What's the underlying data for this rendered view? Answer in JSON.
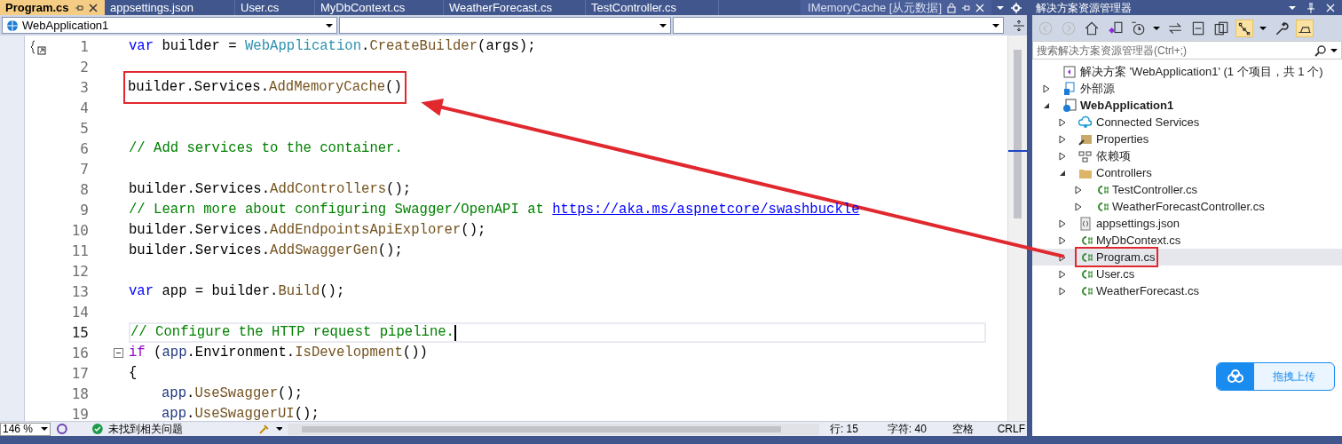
{
  "tabs": [
    {
      "label": "Program.cs",
      "selected": true,
      "pinned": true
    },
    {
      "label": "appsettings.json",
      "selected": false,
      "pinned": false
    },
    {
      "label": "User.cs",
      "selected": false,
      "pinned": false
    },
    {
      "label": "MyDbContext.cs",
      "selected": false,
      "pinned": false
    },
    {
      "label": "WeatherForecast.cs",
      "selected": false,
      "pinned": false
    },
    {
      "label": "TestController.cs",
      "selected": false,
      "pinned": false
    }
  ],
  "preview_tab": {
    "label": "IMemoryCache [从元数据]"
  },
  "nav_bar": {
    "project": "WebApplication1"
  },
  "code_lines": [
    {
      "number": "1",
      "current": false,
      "boxed": false,
      "foldable": false,
      "indented": false,
      "tokens": [
        {
          "text": "var",
          "kind": "keyword"
        },
        {
          "text": " builder = ",
          "kind": "plain"
        },
        {
          "text": "WebApplication",
          "kind": "type"
        },
        {
          "text": ".",
          "kind": "plain"
        },
        {
          "text": "CreateBuilder",
          "kind": "method"
        },
        {
          "text": "(args);",
          "kind": "plain"
        }
      ]
    },
    {
      "number": "2"
    },
    {
      "number": "3",
      "current": false,
      "boxed": true,
      "foldable": false,
      "indented": false,
      "tokens": [
        {
          "text": "builder.Services.",
          "kind": "plain"
        },
        {
          "text": "AddMemoryCache",
          "kind": "method"
        },
        {
          "text": "()",
          "kind": "plain"
        }
      ]
    },
    {
      "number": "4"
    },
    {
      "number": "5"
    },
    {
      "number": "6",
      "current": false,
      "boxed": false,
      "foldable": false,
      "indented": false,
      "tokens": [
        {
          "text": "// Add services to the container.",
          "kind": "comment"
        }
      ]
    },
    {
      "number": "7"
    },
    {
      "number": "8",
      "current": false,
      "boxed": false,
      "foldable": false,
      "indented": false,
      "tokens": [
        {
          "text": "builder.Services.",
          "kind": "plain"
        },
        {
          "text": "AddControllers",
          "kind": "method"
        },
        {
          "text": "();",
          "kind": "plain"
        }
      ]
    },
    {
      "number": "9",
      "current": false,
      "boxed": false,
      "foldable": false,
      "indented": false,
      "tokens": [
        {
          "text": "// Learn more about configuring Swagger/OpenAPI at ",
          "kind": "comment"
        },
        {
          "text": "https://aka.ms/aspnetcore/swashbuckle",
          "kind": "link"
        }
      ]
    },
    {
      "number": "10",
      "current": false,
      "boxed": false,
      "foldable": false,
      "indented": false,
      "tokens": [
        {
          "text": "builder.Services.",
          "kind": "plain"
        },
        {
          "text": "AddEndpointsApiExplorer",
          "kind": "method"
        },
        {
          "text": "();",
          "kind": "plain"
        }
      ]
    },
    {
      "number": "11",
      "current": false,
      "boxed": false,
      "foldable": false,
      "indented": false,
      "tokens": [
        {
          "text": "builder.Services.",
          "kind": "plain"
        },
        {
          "text": "AddSwaggerGen",
          "kind": "method"
        },
        {
          "text": "();",
          "kind": "plain"
        }
      ]
    },
    {
      "number": "12"
    },
    {
      "number": "13",
      "current": false,
      "boxed": false,
      "foldable": false,
      "indented": false,
      "tokens": [
        {
          "text": "var",
          "kind": "keyword"
        },
        {
          "text": " app = builder.",
          "kind": "plain"
        },
        {
          "text": "Build",
          "kind": "method"
        },
        {
          "text": "();",
          "kind": "plain"
        }
      ]
    },
    {
      "number": "14"
    },
    {
      "number": "15",
      "current": true,
      "boxed": false,
      "foldable": false,
      "indented": false,
      "tokens": [
        {
          "text": "// Configure the HTTP request pipeline.",
          "kind": "comment"
        }
      ]
    },
    {
      "number": "16",
      "current": false,
      "boxed": false,
      "foldable": true,
      "indented": false,
      "tokens": [
        {
          "text": "if",
          "kind": "control"
        },
        {
          "text": " (",
          "kind": "plain"
        },
        {
          "text": "app",
          "kind": "variable"
        },
        {
          "text": ".Environment.",
          "kind": "plain"
        },
        {
          "text": "IsDevelopment",
          "kind": "method"
        },
        {
          "text": "())",
          "kind": "plain"
        }
      ]
    },
    {
      "number": "17",
      "current": false,
      "boxed": false,
      "foldable": false,
      "indented": false,
      "tokens": [
        {
          "text": "{",
          "kind": "plain"
        }
      ]
    },
    {
      "number": "18",
      "current": false,
      "boxed": false,
      "foldable": false,
      "indented": true,
      "tokens": [
        {
          "text": "app",
          "kind": "variable"
        },
        {
          "text": ".",
          "kind": "plain"
        },
        {
          "text": "UseSwagger",
          "kind": "method"
        },
        {
          "text": "();",
          "kind": "plain"
        }
      ]
    },
    {
      "number": "19",
      "current": false,
      "boxed": false,
      "foldable": false,
      "indented": true,
      "tokens": [
        {
          "text": "app",
          "kind": "variable"
        },
        {
          "text": ".",
          "kind": "plain"
        },
        {
          "text": "UseSwaggerUI",
          "kind": "method"
        },
        {
          "text": "();",
          "kind": "plain"
        }
      ]
    }
  ],
  "status_bar": {
    "zoom": "146 %",
    "issues": "未找到相关问题",
    "line": "行: 15",
    "char": "字符: 40",
    "spacing": "空格",
    "line_ending": "CRLF"
  },
  "solution_explorer": {
    "title": "解决方案资源管理器",
    "search": {
      "placeholder": "搜索解决方案资源管理器(Ctrl+;)"
    },
    "tree": [
      {
        "label": "解决方案 'WebApplication1' (1 个项目，共 1 个)",
        "kind": "solution",
        "selected": false,
        "boxed": false
      },
      {
        "label": "外部源",
        "kind": "external",
        "expanded": false,
        "selected": false,
        "boxed": false
      },
      {
        "label": "WebApplication1",
        "kind": "project",
        "expanded": true,
        "selected": false,
        "boxed": false,
        "children": [
          {
            "label": "Connected Services",
            "kind": "service",
            "expanded": false,
            "selected": false,
            "boxed": false
          },
          {
            "label": "Properties",
            "kind": "properties",
            "expanded": false,
            "selected": false,
            "boxed": false
          },
          {
            "label": "依赖项",
            "kind": "dependencies",
            "expanded": false,
            "selected": false,
            "boxed": false
          },
          {
            "label": "Controllers",
            "kind": "folder",
            "expanded": true,
            "selected": false,
            "boxed": false,
            "children": [
              {
                "label": "TestController.cs",
                "kind": "cs",
                "expanded": false,
                "selected": false,
                "boxed": false
              },
              {
                "label": "WeatherForecastController.cs",
                "kind": "cs",
                "expanded": false,
                "selected": false,
                "boxed": false
              }
            ]
          },
          {
            "label": "appsettings.json",
            "kind": "json",
            "expanded": false,
            "selected": false,
            "boxed": false
          },
          {
            "label": "MyDbContext.cs",
            "kind": "cs",
            "expanded": false,
            "selected": false,
            "boxed": false
          },
          {
            "label": "Program.cs",
            "kind": "cs",
            "expanded": false,
            "selected": true,
            "boxed": true
          },
          {
            "label": "User.cs",
            "kind": "cs",
            "expanded": false,
            "selected": false,
            "boxed": false
          },
          {
            "label": "WeatherForecast.cs",
            "kind": "cs",
            "expanded": false,
            "selected": false,
            "boxed": false
          }
        ]
      }
    ]
  },
  "upload_button": {
    "label": "拖拽上传"
  }
}
